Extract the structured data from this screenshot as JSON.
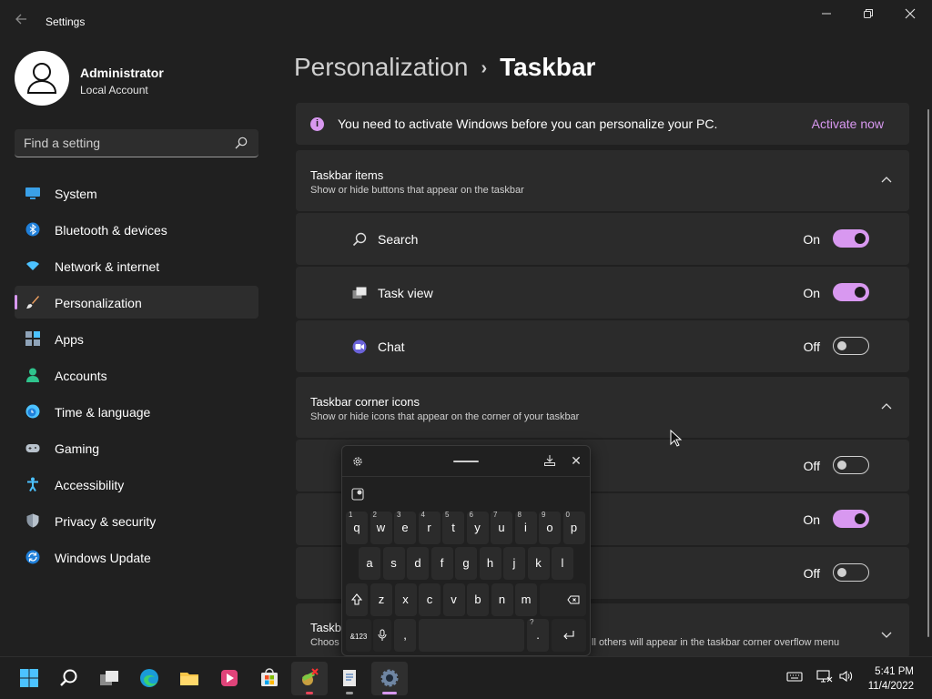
{
  "app": {
    "title": "Settings"
  },
  "profile": {
    "name": "Administrator",
    "type": "Local Account"
  },
  "search": {
    "placeholder": "Find a setting"
  },
  "nav": [
    {
      "label": "System",
      "icon": "system-icon"
    },
    {
      "label": "Bluetooth & devices",
      "icon": "bluetooth-icon"
    },
    {
      "label": "Network & internet",
      "icon": "network-icon"
    },
    {
      "label": "Personalization",
      "icon": "brush-icon",
      "active": true
    },
    {
      "label": "Apps",
      "icon": "apps-icon"
    },
    {
      "label": "Accounts",
      "icon": "accounts-icon"
    },
    {
      "label": "Time & language",
      "icon": "clock-icon"
    },
    {
      "label": "Gaming",
      "icon": "gamepad-icon"
    },
    {
      "label": "Accessibility",
      "icon": "accessibility-icon"
    },
    {
      "label": "Privacy & security",
      "icon": "shield-icon"
    },
    {
      "label": "Windows Update",
      "icon": "update-icon"
    }
  ],
  "breadcrumb": {
    "parent": "Personalization",
    "separator": "›",
    "current": "Taskbar"
  },
  "banner": {
    "text": "You need to activate Windows before you can personalize your PC.",
    "link": "Activate now"
  },
  "groups": {
    "taskbar_items": {
      "title": "Taskbar items",
      "subtitle": "Show or hide buttons that appear on the taskbar",
      "rows": [
        {
          "label": "Search",
          "state": "On",
          "icon": "search-icon"
        },
        {
          "label": "Task view",
          "state": "On",
          "icon": "task-view-icon"
        },
        {
          "label": "Chat",
          "state": "Off",
          "icon": "chat-icon"
        }
      ]
    },
    "corner_icons": {
      "title": "Taskbar corner icons",
      "subtitle": "Show or hide icons that appear on the corner of your taskbar",
      "rows": [
        {
          "state": "Off"
        },
        {
          "state": "On"
        },
        {
          "state": "Off"
        }
      ]
    },
    "overflow": {
      "title": "Taskb",
      "subtitle": "Choos",
      "subtitle_tail": "ll others will appear in the taskbar corner overflow menu"
    }
  },
  "keyboard": {
    "row1": [
      {
        "k": "q",
        "n": "1"
      },
      {
        "k": "w",
        "n": "2"
      },
      {
        "k": "e",
        "n": "3"
      },
      {
        "k": "r",
        "n": "4"
      },
      {
        "k": "t",
        "n": "5"
      },
      {
        "k": "y",
        "n": "6"
      },
      {
        "k": "u",
        "n": "7"
      },
      {
        "k": "i",
        "n": "8"
      },
      {
        "k": "o",
        "n": "9"
      },
      {
        "k": "p",
        "n": "0"
      }
    ],
    "row2": [
      "a",
      "s",
      "d",
      "f",
      "g",
      "h",
      "j",
      "k",
      "l"
    ],
    "row3": [
      "z",
      "x",
      "c",
      "v",
      "b",
      "n",
      "m"
    ],
    "symbols_label": "&123",
    "comma": ",",
    "period": ".",
    "period_alt": "?"
  },
  "clock": {
    "time": "5:41 PM",
    "date": "11/4/2022"
  },
  "colors": {
    "accent": "#d898f0",
    "background": "#202020",
    "card": "#2b2b2b"
  }
}
